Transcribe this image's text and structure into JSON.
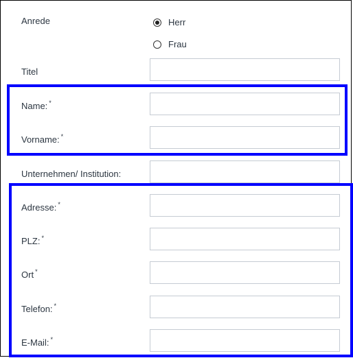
{
  "form": {
    "salutation": {
      "label": "Anrede",
      "options": [
        {
          "label": "Herr",
          "checked": true
        },
        {
          "label": "Frau",
          "checked": false
        }
      ]
    },
    "fields": [
      {
        "key": "titel",
        "label": "Titel",
        "required": false,
        "value": ""
      },
      {
        "key": "name",
        "label": "Name:",
        "required": true,
        "value": ""
      },
      {
        "key": "vorname",
        "label": "Vorname:",
        "required": true,
        "value": ""
      },
      {
        "key": "unternehmen",
        "label": "Unternehmen/ Institution:",
        "required": false,
        "value": ""
      },
      {
        "key": "adresse",
        "label": "Adresse:",
        "required": true,
        "value": ""
      },
      {
        "key": "plz",
        "label": "PLZ:",
        "required": true,
        "value": ""
      },
      {
        "key": "ort",
        "label": "Ort",
        "required": true,
        "value": ""
      },
      {
        "key": "telefon",
        "label": "Telefon:",
        "required": true,
        "value": ""
      },
      {
        "key": "email",
        "label": "E-Mail:",
        "required": true,
        "value": ""
      }
    ],
    "required_marker": "*"
  },
  "colors": {
    "highlight": "#0000ff",
    "frame": "#000000",
    "input_border": "#c5cbd3",
    "text": "#2c3641"
  }
}
